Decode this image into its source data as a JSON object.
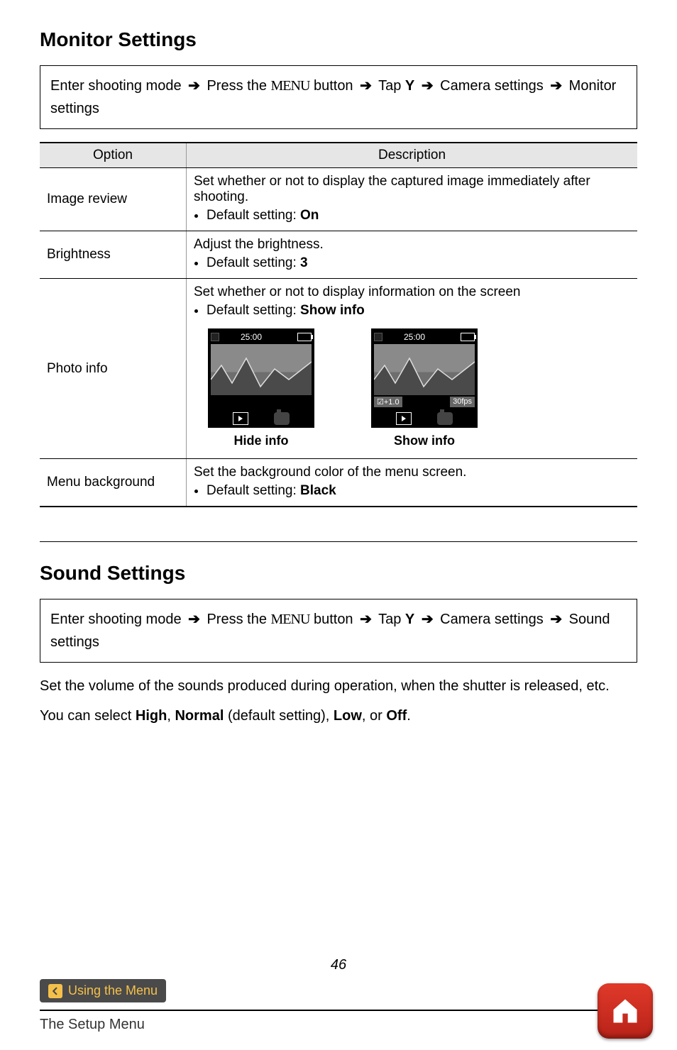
{
  "section1": {
    "title": "Monitor Settings",
    "path": {
      "p1": "Enter shooting mode",
      "p2": "Press the",
      "menuWord": "MENU",
      "p3": "button",
      "p4": "Tap",
      "p5": "Camera settings",
      "p6": "Monitor settings"
    },
    "table": {
      "headers": {
        "option": "Option",
        "description": "Description"
      },
      "rows": {
        "r1": {
          "option": "Image review",
          "desc_line1": "Set whether or not to display the captured image immediately after shooting.",
          "bullet_prefix": "Default setting:",
          "bullet_value": "On"
        },
        "r2": {
          "option": "Brightness",
          "desc_line1": "Adjust the brightness.",
          "bullet_prefix": "Default setting:",
          "bullet_value": "3"
        },
        "r3": {
          "option": "Photo info",
          "desc_line1": "Set whether or not to display information on the screen",
          "bullet_prefix": "Default setting:",
          "bullet_value": "Show info",
          "thumb1": {
            "count": "25:00",
            "label": "Hide info"
          },
          "thumb2": {
            "count": "25:00",
            "ev": "+1.0",
            "fps": "30fps",
            "label": "Show info"
          }
        },
        "r4": {
          "option": "Menu background",
          "desc_line1": "Set the background color of the menu screen.",
          "bullet_prefix": "Default setting:",
          "bullet_value": "Black"
        }
      }
    }
  },
  "section2": {
    "title": "Sound Settings",
    "path": {
      "p1": "Enter shooting mode",
      "p2": "Press the",
      "menuWord": "MENU",
      "p3": "button",
      "p4": "Tap",
      "p5": "Camera settings",
      "p6": "Sound settings"
    },
    "body_line1": "Set the volume of the sounds produced during operation, when the shutter is released, etc.",
    "body_line2_pre": "You can select ",
    "opt_high": "High",
    "sep1": ", ",
    "opt_normal": "Normal",
    "default_note": " (default setting), ",
    "opt_low": "Low",
    "sep2": ", or ",
    "opt_off": "Off",
    "period": "."
  },
  "pageNumber": "46",
  "footer": {
    "chipLabel": "Using the Menu",
    "bottomLabel": "The Setup Menu"
  }
}
